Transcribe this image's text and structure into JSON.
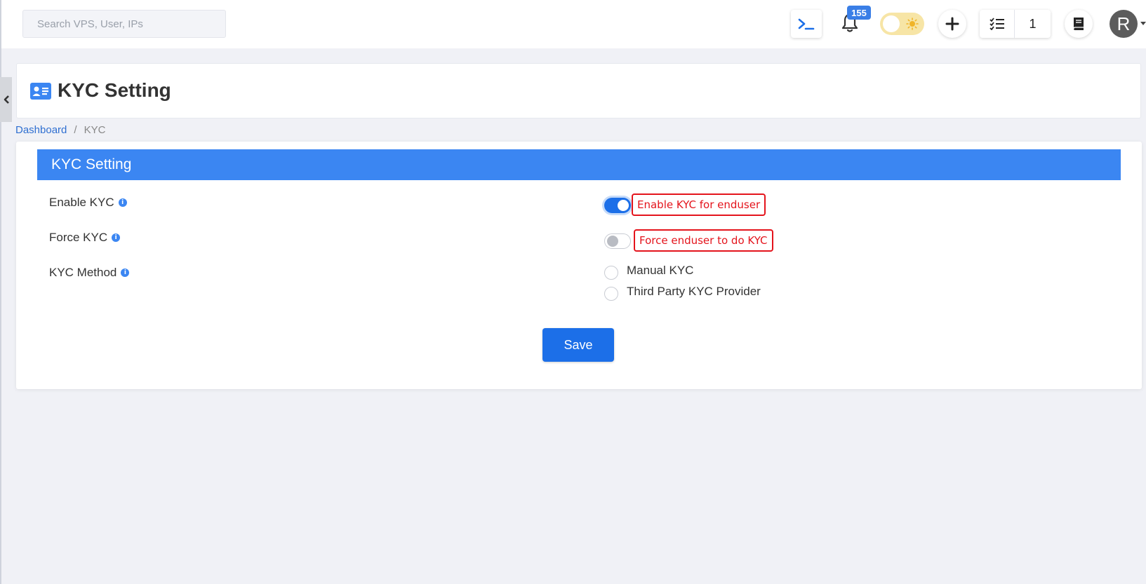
{
  "topbar": {
    "search_placeholder": "Search VPS, User, IPs",
    "notification_count": "155",
    "task_count": "1",
    "avatar_initial": "R"
  },
  "page": {
    "title": "KYC Setting"
  },
  "breadcrumb": {
    "items": [
      "Dashboard",
      "KYC"
    ],
    "separator": "/"
  },
  "card": {
    "title": "KYC Setting",
    "rows": [
      {
        "label": "Enable KYC",
        "annotation": "Enable KYC for enduser",
        "toggle_on": true
      },
      {
        "label": "Force KYC",
        "annotation": "Force enduser to do KYC",
        "toggle_on": false
      },
      {
        "label": "KYC Method"
      }
    ],
    "kyc_methods": [
      "Manual KYC",
      "Third Party KYC Provider"
    ],
    "save_label": "Save"
  },
  "colors": {
    "primary": "#1c6fe8",
    "header_bar": "#3b86f2",
    "annotation": "#e4141c",
    "theme_toggle": "#f7e5a6"
  }
}
